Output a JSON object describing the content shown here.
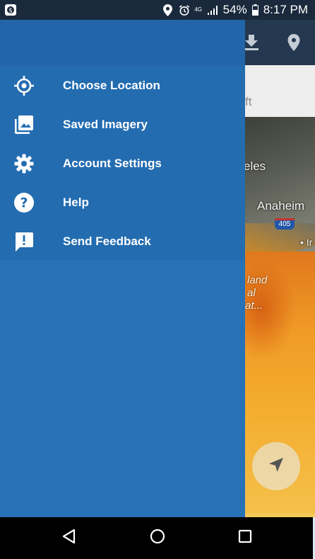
{
  "status_bar": {
    "battery_percent": "54%",
    "time": "8:17 PM",
    "network_label": "4G"
  },
  "search": {
    "visible_text": "ft"
  },
  "map": {
    "labels": {
      "los_angeles_fragment": "eles",
      "anaheim": "Anaheim",
      "irvine_fragment": "• Ir",
      "highway": "405",
      "water_line1": "land",
      "water_line2": "al",
      "water_line3": "at..."
    }
  },
  "drawer": {
    "items": [
      {
        "label": "Choose Location",
        "icon": "crosshair-icon"
      },
      {
        "label": "Saved Imagery",
        "icon": "photo-library-icon"
      },
      {
        "label": "Account Settings",
        "icon": "gear-icon"
      },
      {
        "label": "Help",
        "icon": "help-icon"
      },
      {
        "label": "Send Feedback",
        "icon": "feedback-icon"
      }
    ]
  },
  "colors": {
    "drawer": "#2771b6",
    "drawer_menu": "#236cb0",
    "app_bar": "#24384f",
    "status_bar": "#1a2a3c"
  }
}
